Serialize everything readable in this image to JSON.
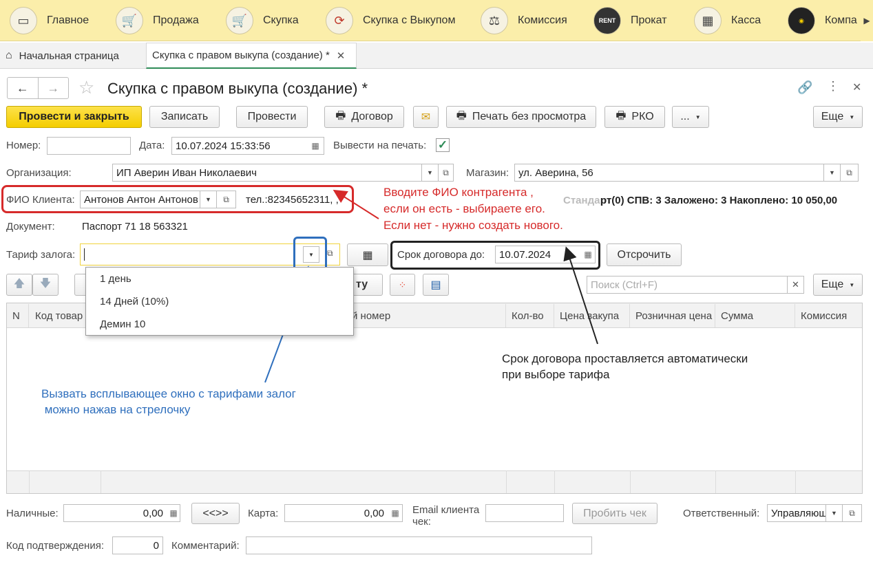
{
  "topnav": {
    "items": [
      {
        "label": "Главное",
        "icon": "monitor-icon"
      },
      {
        "label": "Продажа",
        "icon": "cart-up-icon"
      },
      {
        "label": "Скупка",
        "icon": "cart-down-icon"
      },
      {
        "label": "Скупка с Выкупом",
        "icon": "cycle-arrows-icon"
      },
      {
        "label": "Комиссия",
        "icon": "scales-icon"
      },
      {
        "label": "Прокат",
        "icon": "rent-icon"
      },
      {
        "label": "Касса",
        "icon": "cash-register-icon"
      },
      {
        "label": "Компа",
        "icon": "company-badge-icon"
      }
    ]
  },
  "tabs": {
    "home": "Начальная страница",
    "active": "Скупка с правом выкупа (создание) *",
    "close": "✕"
  },
  "document": {
    "title": "Скупка с правом выкупа (создание) *"
  },
  "toolbar": {
    "post_close": "Провести и закрыть",
    "save": "Записать",
    "post": "Провести",
    "contract": "Договор",
    "print_no_preview": "Печать без просмотра",
    "rko": "РКО",
    "more_dots": "...",
    "more": "Еще"
  },
  "form": {
    "number_label": "Номер:",
    "number_value": "",
    "date_label": "Дата:",
    "date_value": "10.07.2024 15:33:56",
    "print_label": "Вывести на печать:",
    "print_checked": true,
    "org_label": "Организация:",
    "org_value": "ИП Аверин Иван Николаевич",
    "shop_label": "Магазин:",
    "shop_value": "ул. Аверина, 56",
    "client_label": "ФИО Клиента:",
    "client_value": "Антонов Антон Антонов",
    "phone_value": "тел.:82345652311, ,",
    "stats_faded": "Стандарт",
    "stats_text": "рт(0) СПВ: 3 Заложено: 3 Накоплено: 10 050,00",
    "doc_label": "Документ:",
    "doc_value": "Паспорт 71 18 563321",
    "tariff_label": "Тариф залога:",
    "tariff_value": "",
    "term_label": "Срок договора до:",
    "term_value": "10.07.2024",
    "postpone": "Отсрочить"
  },
  "tariff_popup": {
    "options": [
      "1 день",
      "14 Дней (10%)",
      "Демин 10"
    ]
  },
  "table_toolbar": {
    "partial_button": "ту",
    "search_placeholder": "Поиск (Ctrl+F)",
    "more": "Еще"
  },
  "table": {
    "columns": [
      "N",
      "Код товар",
      "Серийный номер",
      "Кол-во",
      "Цена закупа",
      "Розничная цена",
      "Сумма",
      "Комиссия"
    ],
    "visible_serial": "й номер"
  },
  "footer": {
    "cash_label": "Наличные:",
    "cash_value": "0,00",
    "swap": "<<>>",
    "card_label": "Карта:",
    "card_value": "0,00",
    "email_label": "Email клиента чек:",
    "email_label_l1": "Email клиента",
    "email_label_l2": "чек:",
    "receipt": "Пробить чек",
    "responsible_label": "Ответственный:",
    "responsible_value": "Управляющ",
    "code_label": "Код подтверждения:",
    "code_value": "0",
    "comment_label": "Комментарий:",
    "comment_value": ""
  },
  "annotations": {
    "red_l1": "Вводите ФИО контрагента ,",
    "red_l2": "если он есть - выбираете его.",
    "red_l3": "Если нет - нужно создать нового.",
    "blue_l1": "Вызвать всплывающее окно с тарифами залог",
    "blue_l2": " можно нажав на стрелочку",
    "dark_l1": "Срок договора проставляется автоматически",
    "dark_l2": "при выборе тарифа"
  },
  "colors": {
    "topbar": "#fbeeaa",
    "primary_button": "#f4cd00",
    "annotation_red": "#d62a2a",
    "annotation_blue": "#2f6fbd",
    "annotation_dark": "#222222",
    "active_tab_accent": "#2e8b57",
    "checkbox": "#2e8b57"
  }
}
